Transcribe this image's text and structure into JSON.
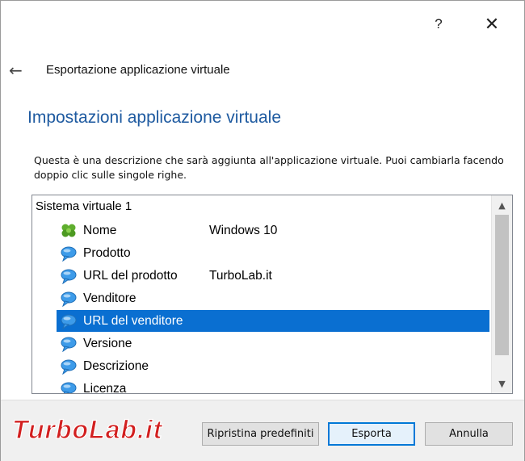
{
  "titlebar": {
    "help_label": "?",
    "close_label": "✕"
  },
  "wizard": {
    "back_icon": "back-arrow-icon",
    "title": "Esportazione applicazione virtuale"
  },
  "page": {
    "heading": "Impostazioni applicazione virtuale",
    "description": "Questa è una descrizione che sarà aggiunta all'applicazione virtuale. Puoi cambiarla facendo doppio clic sulle singole righe."
  },
  "tree": {
    "root_label": "Sistema virtuale 1",
    "rows": [
      {
        "label": "Nome",
        "value": "Windows 10",
        "icon": "clover-icon"
      },
      {
        "label": "Prodotto",
        "value": "",
        "icon": "speech-bubble-icon"
      },
      {
        "label": "URL del prodotto",
        "value": "TurboLab.it",
        "icon": "speech-bubble-icon"
      },
      {
        "label": "Venditore",
        "value": "",
        "icon": "speech-bubble-icon"
      },
      {
        "label": "URL del venditore",
        "value": "",
        "icon": "speech-bubble-icon",
        "selected": true
      },
      {
        "label": "Versione",
        "value": "",
        "icon": "speech-bubble-icon"
      },
      {
        "label": "Descrizione",
        "value": "",
        "icon": "speech-bubble-icon"
      },
      {
        "label": "Licenza",
        "value": "",
        "icon": "speech-bubble-icon"
      }
    ]
  },
  "buttons": {
    "reset_label": "Ripristina predefiniti",
    "export_label": "Esporta",
    "cancel_label": "Annulla"
  },
  "watermark": {
    "text": "TurboLab.it"
  },
  "colors": {
    "heading": "#1e5aa0",
    "selection": "#0a6fd1",
    "logo_red": "#d21f1f"
  }
}
